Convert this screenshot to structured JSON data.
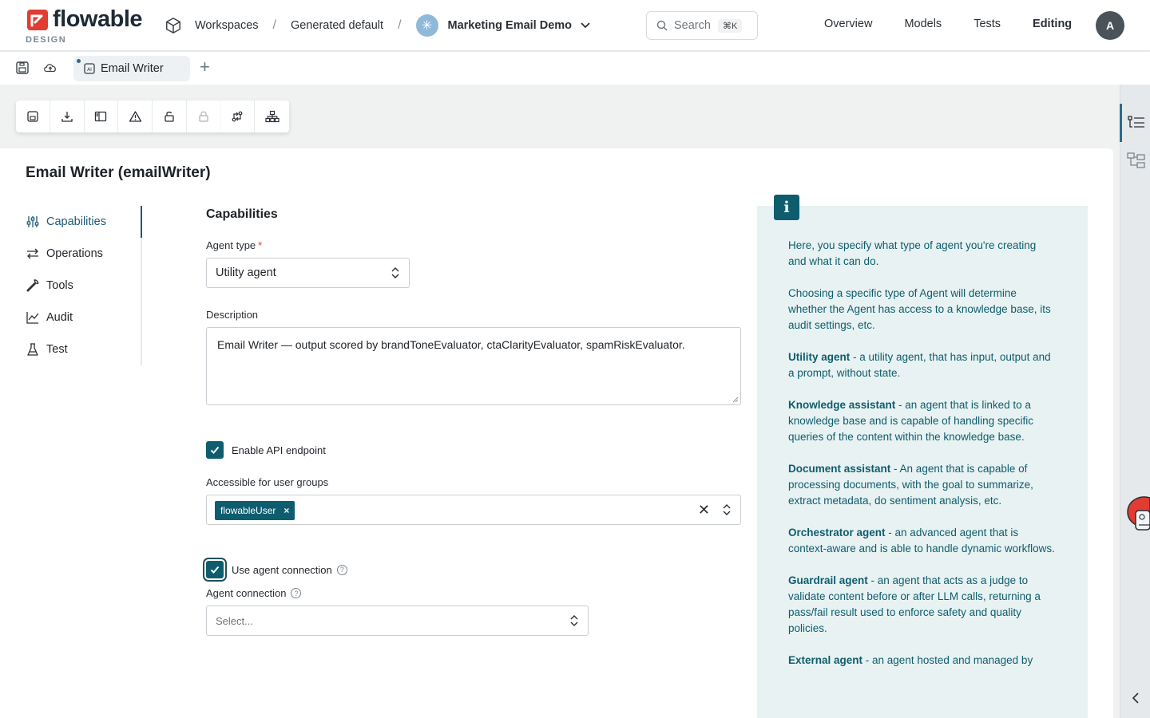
{
  "header": {
    "logo_text": "flowable",
    "logo_sub": "DESIGN",
    "breadcrumbs": [
      "Workspaces",
      "Generated default",
      "Marketing Email Demo"
    ],
    "search_placeholder": "Search",
    "search_shortcut": "⌘K",
    "nav": [
      "Overview",
      "Models",
      "Tests",
      "Editing"
    ],
    "active_nav": "Editing",
    "avatar_initial": "A"
  },
  "tabs": {
    "open_tab": "Email Writer",
    "add_label": "+"
  },
  "toolbar": {
    "buttons": [
      "save-icon",
      "download-icon",
      "panel-icon",
      "warning-icon",
      "unlock-icon",
      "lock-icon",
      "compare-icon",
      "hierarchy-icon"
    ]
  },
  "page": {
    "title": "Email Writer (emailWriter)"
  },
  "sidenav": {
    "items": [
      "Capabilities",
      "Operations",
      "Tools",
      "Audit",
      "Test"
    ],
    "active": "Capabilities"
  },
  "form": {
    "section_title": "Capabilities",
    "agent_type_label": "Agent type",
    "agent_type_value": "Utility agent",
    "description_label": "Description",
    "description_value": "Email Writer — output scored by brandToneEvaluator, ctaClarityEvaluator, spamRiskEvaluator.",
    "enable_api_label": "Enable API endpoint",
    "enable_api_checked": true,
    "user_groups_label": "Accessible for user groups",
    "user_groups": [
      "flowableUser"
    ],
    "use_connection_label": "Use agent connection",
    "use_connection_checked": true,
    "connection_label": "Agent connection",
    "connection_placeholder": "Select..."
  },
  "info": {
    "intro1": "Here, you specify what type of agent you're creating and what it can do.",
    "intro2": "Choosing a specific type of Agent will determine whether the Agent has access to a knowledge base, its audit settings, etc.",
    "types": [
      {
        "name": "Utility agent",
        "desc": " - a utility agent, that has input, output and a prompt, without state."
      },
      {
        "name": "Knowledge assistant",
        "desc": " - an agent that is linked to a knowledge base and is capable of handling specific queries of the content within the knowledge base."
      },
      {
        "name": "Document assistant",
        "desc": " - An agent that is capable of processing documents, with the goal to summarize, extract metadata, do sentiment analysis, etc."
      },
      {
        "name": "Orchestrator agent",
        "desc": " - an advanced agent that is context-aware and is able to handle dynamic workflows."
      },
      {
        "name": "Guardrail agent",
        "desc": " - an agent that acts as a judge to validate content before or after LLM calls, returning a pass/fail result used to enforce safety and quality policies."
      },
      {
        "name": "External agent",
        "desc": " - an agent hosted and managed by"
      }
    ]
  },
  "colors": {
    "accent": "#0e5d6e",
    "brand_red": "#e03c31",
    "info_bg": "#e8f2f2"
  }
}
